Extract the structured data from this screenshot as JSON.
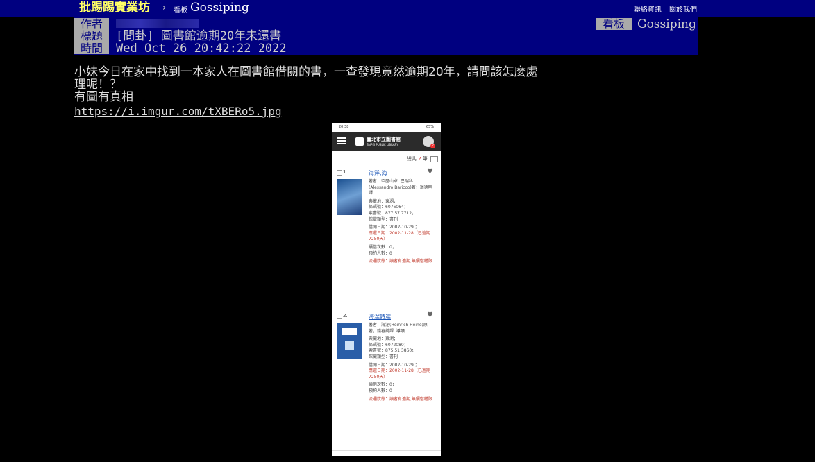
{
  "topbar": {
    "brand": "批踢踢實業坊",
    "separator": "›",
    "board_tag": "看板",
    "board_name": "Gossiping",
    "links": [
      "聯絡資訊",
      "關於我們"
    ]
  },
  "header": {
    "author_label": "作者",
    "title_label": "標題",
    "time_label": "時間",
    "title": "[問卦] 圖書館逾期20年未還書",
    "time": "Wed Oct 26 20:42:22 2022",
    "board_label": "看板",
    "board_value": "Gossiping"
  },
  "content": {
    "lines": [
      "小妹今日在家中找到一本家人在圖書館借閱的書，一查發現竟然逾期20年，請問該怎麼處",
      "理呢！？",
      "有圖有真相"
    ],
    "link": "https://i.imgur.com/tXBERo5.jpg"
  },
  "phone": {
    "status_left": "20:38",
    "status_right": "65%",
    "app_title": "臺北市立圖書館",
    "app_subtitle": "TAIPEI PUBLIC LIBRARY",
    "badge": "2",
    "total_prefix": "總共",
    "total_num": "2",
    "total_suffix": "筆",
    "books": [
      {
        "num": "1.",
        "title": "海洋,海",
        "author": "著者：亞歷山卓. 巴瑞科(Alessandro Baricco)著；翁德明譯",
        "location": "典藏地：東湖；",
        "barcode": "條碼號：6076064；",
        "callno": "索書號：877.57 7712；",
        "type": "館藏類型：書刊",
        "borrow_date": "借閱日期：2002-10-29 ；",
        "due_date": "應還日期：2002-11-28（已逾期7250天）",
        "renew": "續借次數：0；",
        "reserve": "預約人數：0",
        "status": "流通狀態：讀者有逾期,無續借權限"
      },
      {
        "num": "2.",
        "title": "海涅詩選",
        "author": "著者：海涅(Heinrich Heine)原著；錢春綺譯. 導讀",
        "location": "典藏地：東湖；",
        "barcode": "條碼號：6072080；",
        "callno": "索書號：875.51 3860；",
        "type": "館藏類型：書刊",
        "borrow_date": "借閱日期：2002-10-29 ；",
        "due_date": "應還日期：2002-11-28（已逾期7250天）",
        "renew": "續借次數：0；",
        "reserve": "預約人數：0",
        "status": "流通狀態：讀者有逾期,無續借權限"
      }
    ]
  }
}
